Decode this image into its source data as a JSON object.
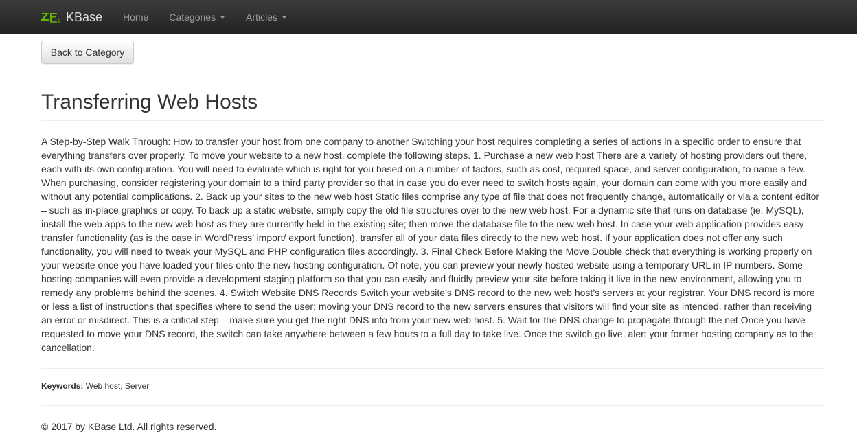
{
  "navbar": {
    "brand": {
      "logo_icon": "zf2-logo-icon",
      "name": "KBase"
    },
    "items": [
      {
        "label": "Home",
        "has_caret": false
      },
      {
        "label": "Categories",
        "has_caret": true
      },
      {
        "label": "Articles",
        "has_caret": true
      }
    ]
  },
  "back_button_label": "Back to Category",
  "article": {
    "title": "Transferring Web Hosts",
    "body": "A Step-by-Step Walk Through: How to transfer your host from one company to another Switching your host requires completing a series of actions in a specific order to ensure that everything transfers over properly. To move your website to a new host, complete the following steps. 1. Purchase a new web host There are a variety of hosting providers out there, each with its own configuration. You will need to evaluate which is right for you based on a number of factors, such as cost, required space, and server configuration, to name a few. When purchasing, consider registering your domain to a third party provider so that in case you do ever need to switch hosts again, your domain can come with you more easily and without any potential complications. 2. Back up your sites to the new web host Static files comprise any type of file that does not frequently change, automatically or via a content editor – such as in-place graphics or copy. To back up a static website, simply copy the old file structures over to the new web host. For a dynamic site that runs on database (ie. MySQL), install the web apps to the new web host as they are currently held in the existing site; then move the database file to the new web host. In case your web application provides easy transfer functionality (as is the case in WordPress’ import/ export function), transfer all of your data files directly to the new web host. If your application does not offer any such functionality, you will need to tweak your MySQL and PHP configuration files accordingly. 3. Final Check Before Making the Move Double check that everything is working properly on your website once you have loaded your files onto the new hosting configuration. Of note, you can preview your newly hosted website using a temporary URL in IP numbers. Some hosting companies will even provide a development staging platform so that you can easily and fluidly preview your site before taking it live in the new environment, allowing you to remedy any problems behind the scenes. 4. Switch Website DNS Records Switch your website’s DNS record to the new web host’s servers at your registrar. Your DNS record is more or less a list of instructions that specifies where to send the user; moving your DNS record to the new servers ensures that visitors will find your site as intended, rather than receiving an error or misdirect. This is a critical step – make sure you get the right DNS info from your new web host. 5. Wait for the DNS change to propagate through the net Once you have requested to move your DNS record, the switch can take anywhere between a few hours to a full day to take live. Once the switch go live, alert your former hosting company as to the cancellation.",
    "keywords_label": "Keywords:",
    "keywords_value": "Web host, Server"
  },
  "footer": {
    "copyright": "© 2017 by KBase Ltd. All rights reserved."
  },
  "colors": {
    "navbar_bg": "#222222",
    "brand_green": "#68b604",
    "nav_text": "#9d9d9d",
    "body_text": "#333333"
  }
}
